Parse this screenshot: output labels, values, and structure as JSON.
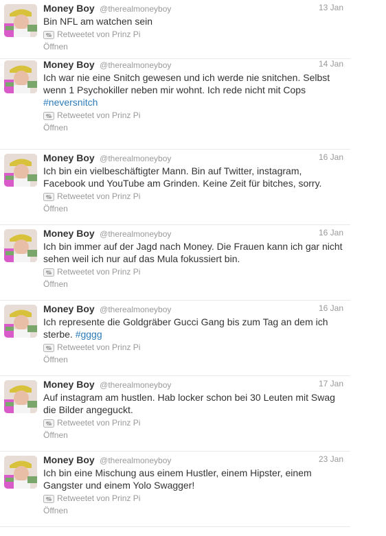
{
  "colors": {
    "hashtag": "#2b7bb9",
    "muted": "#999999",
    "text": "#333333"
  },
  "tweets": [
    {
      "name": "Money Boy",
      "handle": "@therealmoneyboy",
      "time": "13 Jan",
      "text": "Bin NFL am watchen sein",
      "hashtag": "",
      "retweet": "Retweetet von Prinz Pi",
      "open": "Öffnen"
    },
    {
      "name": "Money Boy",
      "handle": "@therealmoneyboy",
      "time": "14 Jan",
      "text": "Ich war nie eine Snitch gewesen und ich werde nie snitchen. Selbst wenn 1 Psychokiller neben mir wohnt. Ich rede nicht mit Cops ",
      "hashtag": "#neversnitch",
      "retweet": "Retweetet von Prinz Pi",
      "open": "Öffnen"
    },
    {
      "name": "Money Boy",
      "handle": "@therealmoneyboy",
      "time": "16 Jan",
      "text": "Ich bin ein vielbeschäftigter Mann. Bin auf Twitter, instagram, Facebook und YouTube am Grinden. Keine Zeit für bitches, sorry.",
      "hashtag": "",
      "retweet": "Retweetet von Prinz Pi",
      "open": "Öffnen"
    },
    {
      "name": "Money Boy",
      "handle": "@therealmoneyboy",
      "time": "16 Jan",
      "text": "Ich bin immer auf der Jagd nach Money. Die Frauen kann ich gar nicht sehen weil ich nur auf das Mula fokussiert bin.",
      "hashtag": "",
      "retweet": "Retweetet von Prinz Pi",
      "open": "Öffnen"
    },
    {
      "name": "Money Boy",
      "handle": "@therealmoneyboy",
      "time": "16 Jan",
      "text": "Ich represente die Goldgräber Gucci Gang bis zum Tag an dem ich sterbe. ",
      "hashtag": "#gggg",
      "retweet": "Retweetet von Prinz Pi",
      "open": "Öffnen"
    },
    {
      "name": "Money Boy",
      "handle": "@therealmoneyboy",
      "time": "17 Jan",
      "text": "Auf instagram am hustlen. Hab locker schon bei 30 Leuten mit Swag die Bilder angeguckt.",
      "hashtag": "",
      "retweet": "Retweetet von Prinz Pi",
      "open": "Öffnen"
    },
    {
      "name": "Money Boy",
      "handle": "@therealmoneyboy",
      "time": "23 Jan",
      "text": "Ich bin eine Mischung aus einem Hustler, einem Hipster, einem Gangster und einem Yolo Swagger!",
      "hashtag": "",
      "retweet": "Retweetet von Prinz Pi",
      "open": "Öffnen"
    }
  ]
}
